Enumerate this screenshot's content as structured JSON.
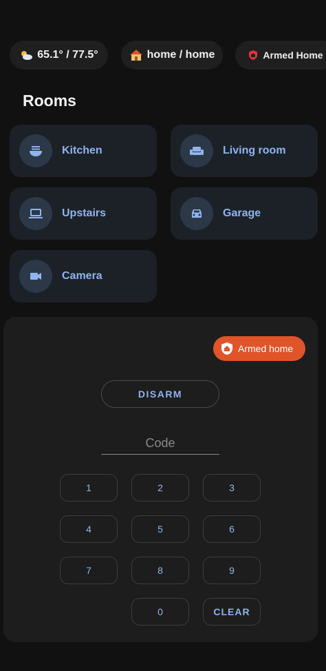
{
  "chips": {
    "weather": {
      "icon": "partly-cloudy-icon",
      "label": "65.1° / 77.5°"
    },
    "presence": {
      "icon": "house-icon",
      "label": "home / home"
    },
    "alarm": {
      "icon": "shield-icon",
      "label": "Armed Home",
      "icon_color": "#e8323c"
    }
  },
  "rooms": {
    "title": "Rooms",
    "items": [
      {
        "label": "Kitchen",
        "icon": "noodle-bowl-icon"
      },
      {
        "label": "Living room",
        "icon": "sofa-icon"
      },
      {
        "label": "Upstairs",
        "icon": "laptop-icon"
      },
      {
        "label": "Garage",
        "icon": "car-icon"
      },
      {
        "label": "Camera",
        "icon": "video-camera-icon"
      }
    ]
  },
  "alarm_panel": {
    "state_label": "Armed home",
    "state_icon": "shield-home-icon",
    "state_color": "#e0542a",
    "disarm_label": "DISARM",
    "code_placeholder": "Code",
    "keys": [
      "1",
      "2",
      "3",
      "4",
      "5",
      "6",
      "7",
      "8",
      "9",
      "0",
      "CLEAR"
    ]
  },
  "colors": {
    "accent": "#8fb4ef",
    "card": "#1c2128",
    "background": "#111111"
  }
}
